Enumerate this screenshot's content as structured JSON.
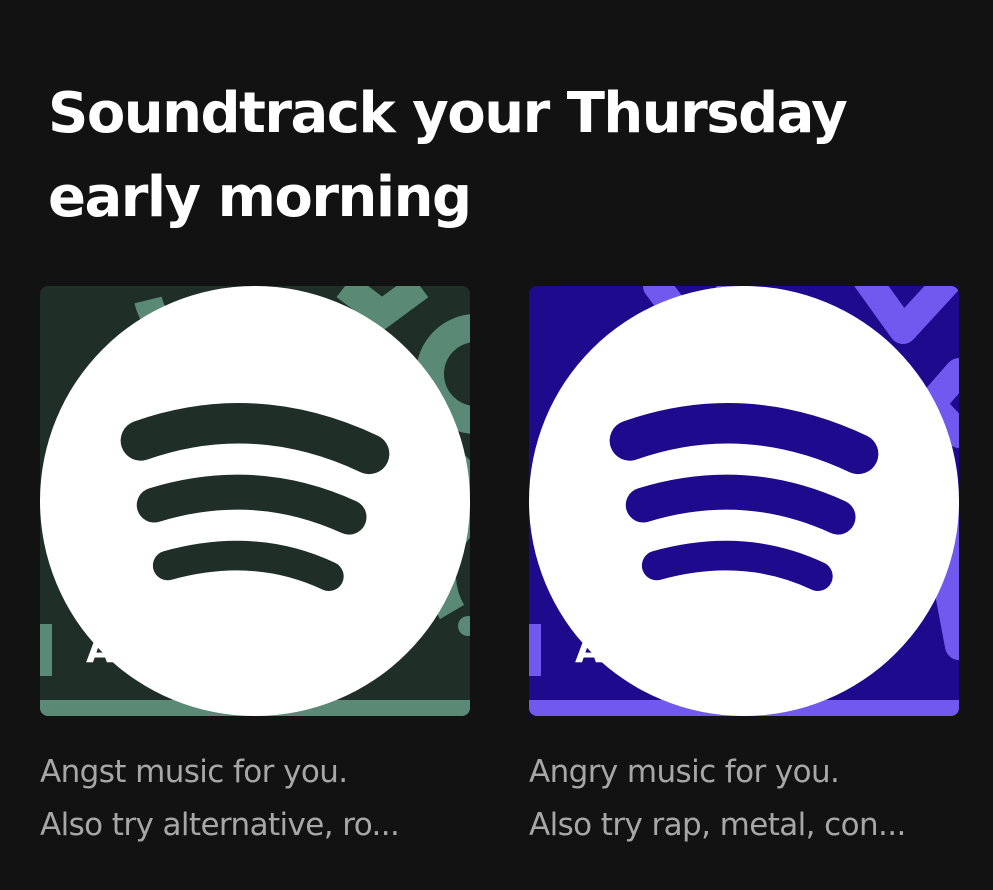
{
  "section": {
    "title_line1": "Soundtrack your Thursday",
    "title_line2": "early morning"
  },
  "cards": [
    {
      "title": "Angst Mix",
      "description_line1": "Angst music for you.",
      "description_line2": "Also try alternative, ro...",
      "logo_icon": "spotify-logo-icon",
      "colors": {
        "background": "#1f2f28",
        "accent": "#5a8a75"
      }
    },
    {
      "title": "Angry Mix",
      "description_line1": "Angry music for you.",
      "description_line2": "Also try rap, metal, con...",
      "logo_icon": "spotify-logo-icon",
      "colors": {
        "background": "#1e0a8c",
        "accent": "#7159f0"
      }
    }
  ],
  "colors": {
    "page_background": "#121212",
    "title_text": "#ffffff",
    "description_text": "#a7a7a7"
  }
}
